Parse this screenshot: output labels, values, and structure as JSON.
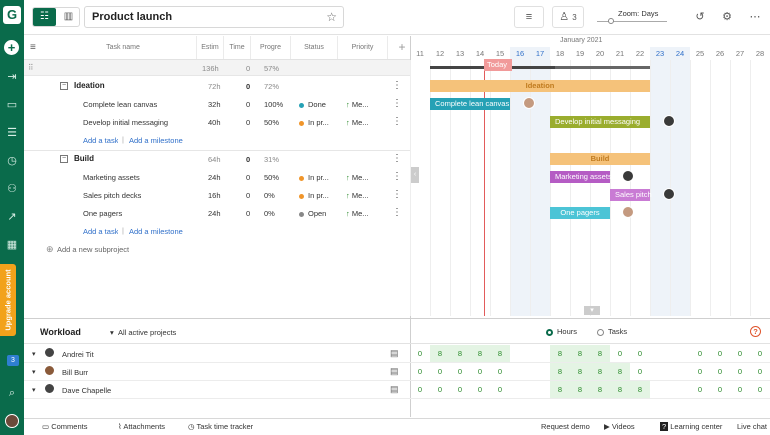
{
  "app": {
    "logo_letter": "G",
    "upgrade_label": "Upgrade account",
    "notification_count": "3"
  },
  "topbar": {
    "project_title": "Product launch",
    "people_count": "3",
    "zoom_label": "Zoom: Days"
  },
  "columns": {
    "task": "Task name",
    "estimate": "Estim",
    "time": "Time",
    "progress": "Progre",
    "status": "Status",
    "priority": "Priority"
  },
  "summary": {
    "estimate": "136h",
    "time": "0",
    "progress": "57%"
  },
  "projects": [
    {
      "name": "Ideation",
      "estimate": "72h",
      "time": "0",
      "progress": "72%",
      "tasks": [
        {
          "name": "Complete lean canvas",
          "estimate": "32h",
          "time": "0",
          "progress": "100%",
          "status": "Done",
          "priority": "Me..."
        },
        {
          "name": "Develop initial messaging",
          "estimate": "40h",
          "time": "0",
          "progress": "50%",
          "status": "In pr...",
          "priority": "Me..."
        }
      ],
      "add_task": "Add a task",
      "add_milestone": "Add a milestone"
    },
    {
      "name": "Build",
      "estimate": "64h",
      "time": "0",
      "progress": "31%",
      "tasks": [
        {
          "name": "Marketing assets",
          "estimate": "24h",
          "time": "0",
          "progress": "50%",
          "status": "In pr...",
          "priority": "Me..."
        },
        {
          "name": "Sales pitch decks",
          "estimate": "16h",
          "time": "0",
          "progress": "0%",
          "status": "In pr...",
          "priority": "Me..."
        },
        {
          "name": "One pagers",
          "estimate": "24h",
          "time": "0",
          "progress": "0%",
          "status": "Open",
          "priority": "Me..."
        }
      ],
      "add_task": "Add a task",
      "add_milestone": "Add a milestone"
    }
  ],
  "add_subproject": "Add a new subproject",
  "gantt": {
    "month": "January 2021",
    "days": [
      "11",
      "12",
      "13",
      "14",
      "15",
      "16",
      "17",
      "18",
      "19",
      "20",
      "21",
      "22",
      "23",
      "24",
      "25",
      "26",
      "27",
      "28"
    ],
    "today_label": "Today",
    "bars": {
      "ideation": "Ideation",
      "lean_canvas": "Complete lean canvas",
      "messaging": "Develop initial messaging",
      "build": "Build",
      "marketing": "Marketing assets",
      "pitch": "Sales pitch",
      "one_pagers": "One pagers"
    }
  },
  "colors": {
    "brand": "#0a6b4b",
    "teal": "#26a1b5",
    "olive": "#9aad2e",
    "purple": "#b55cc4",
    "cyan": "#4cc4d6",
    "orange": "#f5c27a",
    "status_done": "#26a1b5",
    "status_progress": "#f0952a",
    "status_open": "#888888"
  },
  "workload": {
    "title": "Workload",
    "filter": "All active projects",
    "hours_label": "Hours",
    "tasks_label": "Tasks",
    "people": [
      {
        "name": "Andrei Tit",
        "values": [
          "0",
          "8",
          "8",
          "8",
          "8",
          "",
          "",
          "8",
          "8",
          "8",
          "0",
          "0",
          "",
          "",
          "0",
          "0",
          "0",
          "0"
        ]
      },
      {
        "name": "Bill Burr",
        "values": [
          "0",
          "0",
          "0",
          "0",
          "0",
          "",
          "",
          "8",
          "8",
          "8",
          "8",
          "0",
          "",
          "",
          "0",
          "0",
          "0",
          "0"
        ]
      },
      {
        "name": "Dave Chapelle",
        "values": [
          "0",
          "0",
          "0",
          "0",
          "0",
          "",
          "",
          "8",
          "8",
          "8",
          "8",
          "8",
          "",
          "",
          "0",
          "0",
          "0",
          "0"
        ]
      }
    ]
  },
  "bottombar": {
    "comments": "Comments",
    "attachments": "Attachments",
    "time_tracker": "Task time tracker",
    "request_demo": "Request demo",
    "videos": "Videos",
    "learning": "Learning center",
    "live_chat": "Live chat"
  }
}
